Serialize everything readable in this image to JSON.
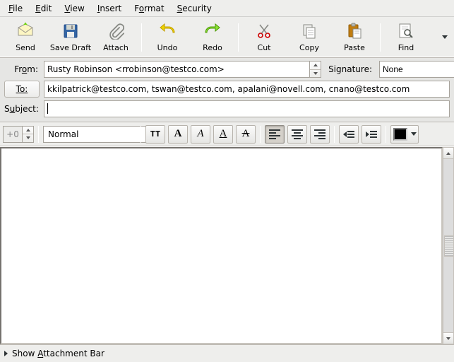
{
  "menubar": {
    "file": "ile",
    "edit": "dit",
    "view": "iew",
    "insert": "nsert",
    "format": "mat",
    "security": "ecurity"
  },
  "toolbar": {
    "send": "Send",
    "save_draft": "Save Draft",
    "attach": "Attach",
    "undo": "Undo",
    "redo": "Redo",
    "cut": "Cut",
    "copy": "Copy",
    "paste": "Paste",
    "find": "Find"
  },
  "headers": {
    "from_label": "m:",
    "from_value": "Rusty Robinson <rrobinson@testco.com>",
    "signature_label": "Signature:",
    "signature_value": "None",
    "to_label": "o:",
    "to_value": "kkilpatrick@testco.com, tswan@testco.com, apalani@novell.com, cnano@testco.com",
    "subject_label": "bject:",
    "subject_value": ""
  },
  "format": {
    "size_value": "+0",
    "style_value": "Normal",
    "color": "#000000"
  },
  "body": "",
  "status": {
    "attachment_bar": "ttachment Bar"
  }
}
